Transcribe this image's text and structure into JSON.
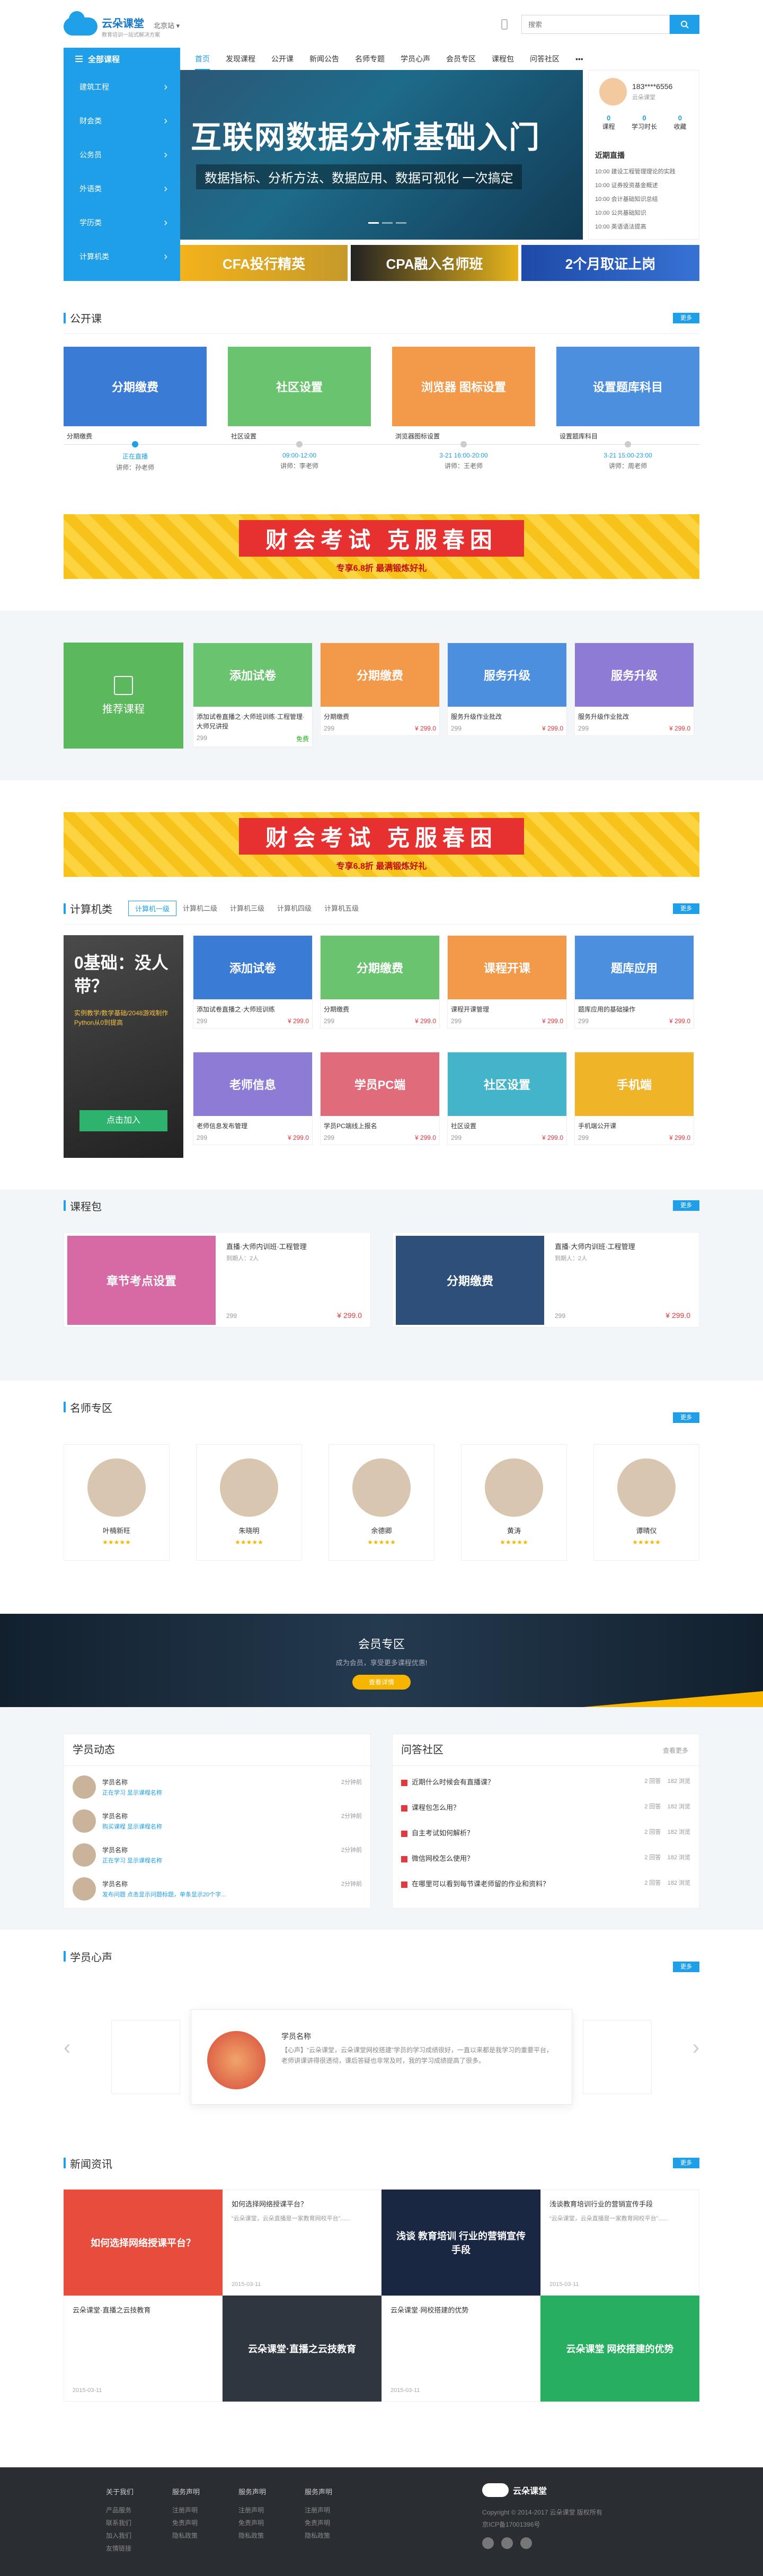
{
  "header": {
    "logo_title": "云朵课堂",
    "logo_sub": "教育培训一站式解决方案",
    "city": "北京站",
    "search_placeholder": "搜索",
    "accent": "#1e9fe8"
  },
  "nav": {
    "all_courses": "全部课程",
    "items": [
      "首页",
      "发现课程",
      "公开课",
      "新闻公告",
      "名师专题",
      "学员心声",
      "会员专区",
      "课程包",
      "问答社区",
      "•••"
    ]
  },
  "categories": [
    "建筑工程",
    "财会类",
    "公务员",
    "外语类",
    "学历类",
    "计算机类"
  ],
  "banner": {
    "title": "互联网数据分析基础入门",
    "subtitle": "数据指标、分析方法、数据应用、数据可视化 一次搞定"
  },
  "user": {
    "name": "183****6556",
    "sub": "云朵课堂",
    "stats": [
      {
        "label": "课程",
        "value": "0"
      },
      {
        "label": "学习时长",
        "value": "0"
      },
      {
        "label": "收藏",
        "value": "0"
      }
    ],
    "live_title": "近期直播",
    "live": [
      "10:00 建设工程管理理论的实践",
      "10:00 证券投资基金概述",
      "10:00 会计基础知识总结",
      "10:00 公共基础知识",
      "10:00 英语语法提高"
    ]
  },
  "promos": [
    "CFA投行精英",
    "CPA融入名师班",
    "2个月取证上岗"
  ],
  "open_course": {
    "title": "公开课",
    "more": "更多",
    "cards": [
      {
        "thumb": "分期缴费",
        "title": "分期缴费"
      },
      {
        "thumb": "社区设置",
        "title": "社区设置"
      },
      {
        "thumb": "浏览器 图标设置",
        "title": "浏览器图标设置"
      },
      {
        "thumb": "设置题库科目",
        "title": "设置题库科目"
      }
    ],
    "timeline": [
      {
        "status": "正在直播",
        "teacher": "讲师：孙老师"
      },
      {
        "status": "09:00-12:00",
        "teacher": "讲师：李老师"
      },
      {
        "status": "3-21 16:00-20:00",
        "teacher": "讲师：王老师"
      },
      {
        "status": "3-21 15:00-23:00",
        "teacher": "讲师：周老师"
      }
    ]
  },
  "ad": {
    "title": "财会考试 克服春困",
    "sub": "专享6.8折 最满锻炼好礼"
  },
  "recommend": {
    "label": "推荐课程",
    "cards": [
      {
        "thumb": "添加试卷",
        "title": "添加试卷直播之·大师班训练·工程管理·大师兄讲授",
        "count": "299",
        "price": "免费"
      },
      {
        "thumb": "分期缴费",
        "title": "分期缴费",
        "count": "299",
        "price": "¥ 299.0"
      },
      {
        "thumb": "服务升级",
        "title": "服务升级作业批改",
        "count": "299",
        "price": "¥ 299.0"
      },
      {
        "thumb": "服务升级",
        "title": "服务升级作业批改",
        "count": "299",
        "price": "¥ 299.0"
      }
    ]
  },
  "computer": {
    "title": "计算机类",
    "more": "更多",
    "tabs": [
      "计算机一级",
      "计算机二级",
      "计算机三级",
      "计算机四级",
      "计算机五级"
    ],
    "promo_title": "0基础：没人带？",
    "promo_sub": "实例教学/数学基础/2048游戏制作 Python从0到提高",
    "promo_btn": "点击加入",
    "cards": [
      {
        "thumb": "添加试卷",
        "title": "添加试卷直播之·大师班训练",
        "count": "299",
        "price": "¥ 299.0"
      },
      {
        "thumb": "分期缴费",
        "title": "分期缴费",
        "count": "299",
        "price": "¥ 299.0"
      },
      {
        "thumb": "课程开课",
        "title": "课程开课管理",
        "count": "299",
        "price": "¥ 299.0"
      },
      {
        "thumb": "题库应用",
        "title": "题库应用的基础操作",
        "count": "299",
        "price": "¥ 299.0"
      },
      {
        "thumb": "老师信息",
        "title": "老师信息发布管理",
        "count": "299",
        "price": "¥ 299.0"
      },
      {
        "thumb": "学员PC端",
        "title": "学员PC端线上报名",
        "count": "299",
        "price": "¥ 299.0"
      },
      {
        "thumb": "社区设置",
        "title": "社区设置",
        "count": "299",
        "price": "¥ 299.0"
      },
      {
        "thumb": "手机端",
        "title": "手机端公开课",
        "count": "299",
        "price": "¥ 299.0"
      }
    ]
  },
  "package": {
    "title": "课程包",
    "more": "更多",
    "items": [
      {
        "thumb": "章节考点设置",
        "title": "直播·大师内训班·工程管理",
        "sub": "到期人：2人",
        "count": "299",
        "price": "¥ 299.0"
      },
      {
        "thumb": "分期缴费",
        "title": "直播·大师内训班·工程管理",
        "sub": "到期人：2人",
        "count": "299",
        "price": "¥ 299.0"
      }
    ]
  },
  "teachers": {
    "title": "名师专区",
    "more": "更多",
    "list": [
      {
        "name": "叶楠新旺"
      },
      {
        "name": "朱晓明"
      },
      {
        "name": "余德卿"
      },
      {
        "name": "黄涛"
      },
      {
        "name": "谭晴仪"
      }
    ]
  },
  "member": {
    "title": "会员专区",
    "sub": "成为会员，享受更多课程优惠!",
    "btn": "查看详情"
  },
  "dynamics": {
    "title": "学员动态",
    "items": [
      {
        "name": "学员名称",
        "action": "正在学习 显示课程名称",
        "time": "2分钟前"
      },
      {
        "name": "学员名称",
        "action": "购买课程 显示课程名称",
        "time": "2分钟前"
      },
      {
        "name": "学员名称",
        "action": "正在学习 显示课程名称",
        "time": "2分钟前"
      },
      {
        "name": "学员名称",
        "action": "发布问题 点击显示问题标题，单条显示20个字...",
        "time": "2分钟前"
      }
    ]
  },
  "qa": {
    "title": "问答社区",
    "more": "查看更多",
    "items": [
      {
        "q": "近期什么时候会有直播课？",
        "stat": "2 回答    182 浏览"
      },
      {
        "q": "课程包怎么用？",
        "stat": "2 回答    182 浏览"
      },
      {
        "q": "自主考试如何解析？",
        "stat": "2 回答    182 浏览"
      },
      {
        "q": "微信网校怎么使用？",
        "stat": "2 回答    182 浏览"
      },
      {
        "q": "在哪里可以看到每节课老师留的作业和资料？",
        "stat": "2 回答    182 浏览"
      }
    ]
  },
  "voice": {
    "title": "学员心声",
    "more": "更多",
    "name": "学员名称",
    "text": "【心声】“云朵课堂，云朵课堂网校搭建”学员的学习成绩很好，一直以来都是我学习的重要平台，老师讲课讲得很透彻，课后答疑也非常及时，我的学习成绩提高了很多。"
  },
  "news": {
    "title": "新闻资讯",
    "more": "更多",
    "items": [
      {
        "thumb": "如何选择网络授课平台？",
        "title": "如何选择网络授课平台？",
        "desc": "“云朵课堂，云朵直播是一家教育网校平台”......",
        "date": "2015-03-11"
      },
      {
        "thumb": "浅谈 教育培训 行业的营销宣传手段",
        "title": "浅谈教育培训行业的营销宣传手段",
        "desc": "“云朵课堂，云朵直播是一家教育网校平台”......",
        "date": "2015-03-11"
      },
      {
        "thumb": "云朵课堂·直播之云技教育",
        "title": "云朵课堂·直播之云技教育",
        "desc": "",
        "date": "2015-03-11"
      },
      {
        "thumb": "云朵课堂 网校搭建的优势",
        "title": "云朵课堂·网校搭建的优势",
        "desc": "",
        "date": "2015-03-11"
      }
    ]
  },
  "footer": {
    "cols": [
      {
        "head": "关于我们",
        "links": [
          "产品服务",
          "联系我们",
          "加入我们",
          "友情链接"
        ]
      },
      {
        "head": "服务声明",
        "links": [
          "注册声明",
          "免责声明",
          "隐私政策"
        ]
      },
      {
        "head": "服务声明",
        "links": [
          "注册声明",
          "免责声明",
          "隐私政策"
        ]
      },
      {
        "head": "服务声明",
        "links": [
          "注册声明",
          "免责声明",
          "隐私政策"
        ]
      }
    ],
    "copyright": "Copyright © 2014-2017 云朵课堂 版权所有",
    "icp": "京ICP备17001396号"
  }
}
